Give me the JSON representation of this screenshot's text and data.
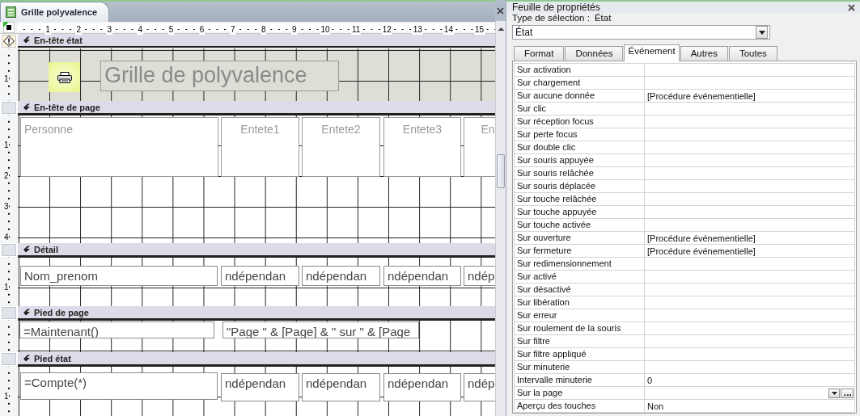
{
  "document_tab": {
    "title": "Grille polyvalence"
  },
  "ruler": [
    "1",
    "2",
    "3",
    "4",
    "5",
    "6",
    "7",
    "8",
    "9",
    "10",
    "11",
    "12",
    "13",
    "14",
    "15"
  ],
  "sections": [
    {
      "title": "En-tête état",
      "shaded": true,
      "ruler": [
        "1"
      ],
      "controls": [
        {
          "kind": "logo"
        },
        {
          "kind": "title",
          "text": "Grille de polyvalence"
        }
      ]
    },
    {
      "title": "En-tête de page",
      "shaded": false,
      "ruler": [
        "1",
        "2",
        "3",
        "4"
      ],
      "controls": [
        {
          "kind": "label",
          "text": "Personne"
        },
        {
          "kind": "label",
          "text": "Entete1"
        },
        {
          "kind": "label",
          "text": "Entete2"
        },
        {
          "kind": "label",
          "text": "Entete3"
        },
        {
          "kind": "label",
          "text": "En"
        }
      ]
    },
    {
      "title": "Détail",
      "shaded": false,
      "ruler": [
        "1"
      ],
      "controls": [
        {
          "kind": "textbox",
          "text": "Nom_prenom"
        },
        {
          "kind": "textbox",
          "text": "ndépendan"
        },
        {
          "kind": "textbox",
          "text": "ndépendan"
        },
        {
          "kind": "textbox",
          "text": "ndépendan"
        },
        {
          "kind": "textbox",
          "text": "ndép"
        }
      ]
    },
    {
      "title": "Pied de page",
      "shaded": false,
      "controls": [
        {
          "kind": "textbox",
          "text": "=Maintenant()"
        },
        {
          "kind": "textbox",
          "text": "\"Page \" & [Page] & \" sur \" & [Page"
        }
      ]
    },
    {
      "title": "Pied état",
      "shaded": false,
      "ruler": [
        "1"
      ],
      "controls": [
        {
          "kind": "textbox",
          "text": "=Compte(*)"
        },
        {
          "kind": "textbox",
          "text": "ndépendan"
        },
        {
          "kind": "textbox",
          "text": "ndépendan"
        },
        {
          "kind": "textbox",
          "text": "ndépendan"
        },
        {
          "kind": "textbox",
          "text": "ndép"
        }
      ]
    }
  ],
  "property_sheet": {
    "title": "Feuille de propriétés",
    "selection_label": "Type de sélection :",
    "selection_value": "État",
    "object_combo": "État",
    "tabs": [
      {
        "label": "Format",
        "selected": false
      },
      {
        "label": "Données",
        "selected": false
      },
      {
        "label": "Événement",
        "selected": true
      },
      {
        "label": "Autres",
        "selected": false
      },
      {
        "label": "Toutes",
        "selected": false
      }
    ],
    "rows": [
      {
        "kind": "text",
        "label": "Sur activation"
      },
      {
        "kind": "text",
        "label": "Sur chargement"
      },
      {
        "kind": "text",
        "label": "Sur aucune donnée",
        "value": "[Procédure événementielle]"
      },
      {
        "kind": "text",
        "label": "Sur clic"
      },
      {
        "kind": "text",
        "label": "Sur réception focus"
      },
      {
        "kind": "text",
        "label": "Sur perte focus"
      },
      {
        "kind": "text",
        "label": "Sur double clic"
      },
      {
        "kind": "text",
        "label": "Sur souris appuyée"
      },
      {
        "kind": "text",
        "label": "Sur souris relâchée"
      },
      {
        "kind": "text",
        "label": "Sur souris déplacée"
      },
      {
        "kind": "text",
        "label": "Sur touche relâchée"
      },
      {
        "kind": "text",
        "label": "Sur touche appuyée"
      },
      {
        "kind": "text",
        "label": "Sur touche activée"
      },
      {
        "kind": "text",
        "label": "Sur ouverture",
        "value": "[Procédure événementielle]"
      },
      {
        "kind": "text",
        "label": "Sur fermeture",
        "value": "[Procédure événementielle]"
      },
      {
        "kind": "text",
        "label": "Sur redimensionnement"
      },
      {
        "kind": "text",
        "label": "Sur activé"
      },
      {
        "kind": "text",
        "label": "Sur désactivé"
      },
      {
        "kind": "text",
        "label": "Sur libération"
      },
      {
        "kind": "text",
        "label": "Sur erreur"
      },
      {
        "kind": "text",
        "label": "Sur roulement de la souris"
      },
      {
        "kind": "text",
        "label": "Sur filtre"
      },
      {
        "kind": "text",
        "label": "Sur filtre appliqué"
      },
      {
        "kind": "text",
        "label": "Sur minuterie"
      },
      {
        "kind": "text",
        "label": "Intervalle minuterie",
        "value": "0"
      },
      {
        "kind": "picker",
        "label": "Sur la page",
        "builder_label": "..."
      },
      {
        "kind": "text",
        "label": "Aperçu des touches",
        "value": "Non"
      }
    ]
  }
}
